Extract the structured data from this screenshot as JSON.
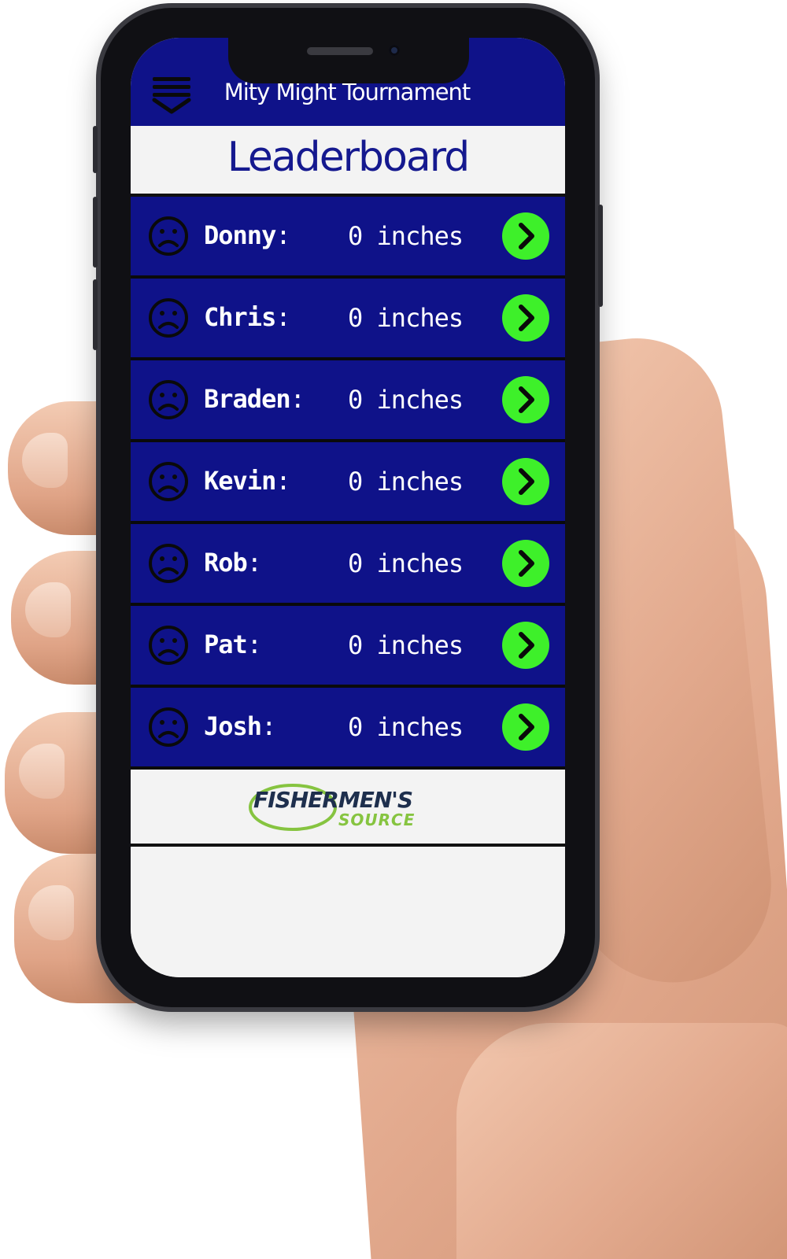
{
  "header": {
    "title": "Mity Might Tournament",
    "menu_icon": "hamburger-chevron-icon"
  },
  "section": {
    "title": "Leaderboard"
  },
  "players": [
    {
      "name": "Donny",
      "score": "0 inches",
      "status_icon": "sad-face-icon"
    },
    {
      "name": "Chris",
      "score": "0 inches",
      "status_icon": "sad-face-icon"
    },
    {
      "name": "Braden",
      "score": "0 inches",
      "status_icon": "sad-face-icon"
    },
    {
      "name": "Kevin",
      "score": "0 inches",
      "status_icon": "sad-face-icon"
    },
    {
      "name": "Rob",
      "score": "0 inches",
      "status_icon": "sad-face-icon"
    },
    {
      "name": "Pat",
      "score": "0 inches",
      "status_icon": "sad-face-icon"
    },
    {
      "name": "Josh",
      "score": "0 inches",
      "status_icon": "sad-face-icon"
    }
  ],
  "sponsor": {
    "logo_text_top": "FISHERMEN'S",
    "logo_text_bottom": "SOURCE"
  },
  "colors": {
    "primary": "#0f1289",
    "title_text": "#15198f",
    "accent_button": "#3ef02a",
    "background": "#f3f3f3",
    "logo_navy": "#1e2f4d",
    "logo_green": "#86c440"
  }
}
